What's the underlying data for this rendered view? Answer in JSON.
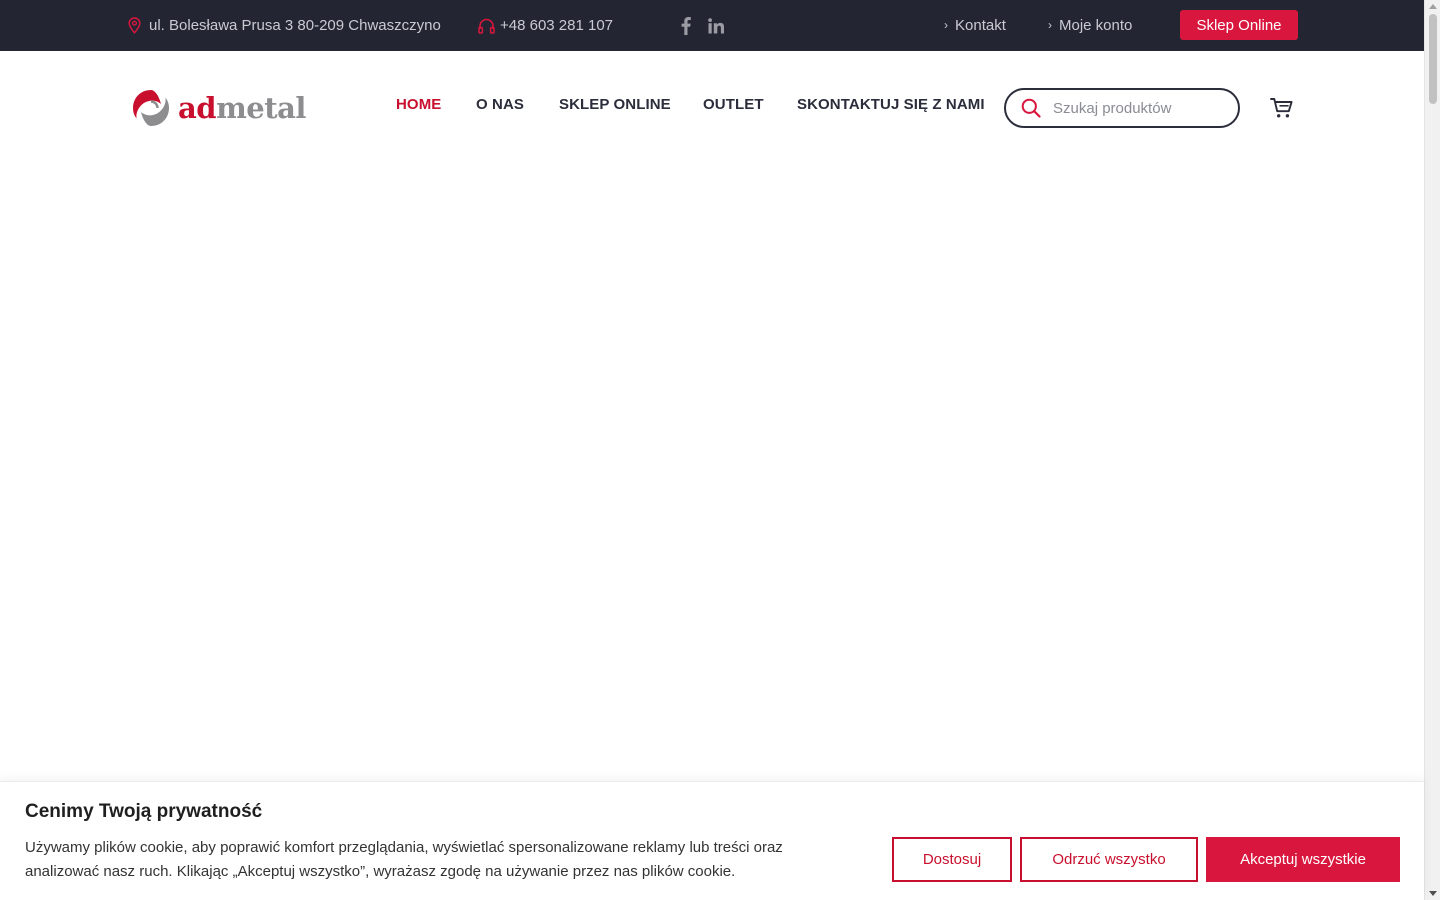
{
  "topbar": {
    "address": "ul. Bolesława Prusa 3 80-209 Chwaszczyno",
    "phone": "+48 603 281 107",
    "links": [
      {
        "label": "Kontakt"
      },
      {
        "label": "Moje konto"
      }
    ],
    "shop_button": "Sklep Online",
    "icons": [
      "location-pin-icon",
      "headphones-icon",
      "facebook-icon",
      "linkedin-icon"
    ]
  },
  "header": {
    "logo": {
      "part1": "ad",
      "part2": "metal"
    },
    "nav": [
      {
        "label": "HOME",
        "active": true
      },
      {
        "label": "O NAS",
        "active": false
      },
      {
        "label": "SKLEP ONLINE",
        "active": false
      },
      {
        "label": "OUTLET",
        "active": false
      },
      {
        "label": "SKONTAKTUJ SIĘ Z NAMI",
        "active": false
      }
    ],
    "search": {
      "placeholder": "Szukaj produktów"
    }
  },
  "cookie": {
    "title": "Cenimy Twoją prywatność",
    "text": "Używamy plików cookie, aby poprawić komfort przeglądania, wyświetlać spersonalizowane reklamy lub treści oraz analizować nasz ruch. Klikając „Akceptuj wszystko”, wyrażasz zgodę na używanie przez nas plików cookie.",
    "buttons": {
      "customize": "Dostosuj",
      "reject": "Odrzuć wszystko",
      "accept": "Akceptuj wszystkie"
    }
  },
  "colors": {
    "accent": "#d9173e",
    "topbar_bg": "#232532",
    "text_dark": "#2b2d3b"
  }
}
